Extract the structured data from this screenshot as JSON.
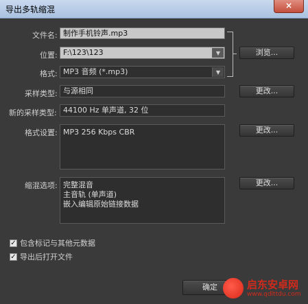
{
  "window": {
    "title": "导出多轨缩混",
    "close_glyph": "×"
  },
  "file_name": {
    "label": "文件名:",
    "value": "制作手机铃声.mp3"
  },
  "location": {
    "label": "位置:",
    "value": "F:\\123\\123",
    "browse_label": "浏览..."
  },
  "format": {
    "label": "格式:",
    "value": "MP3 音频 (*.mp3)"
  },
  "sample_type": {
    "label": "采样类型:",
    "value": "与源相同",
    "change_label": "更改..."
  },
  "new_sample_type": {
    "label": "新的采样类型:",
    "value": "44100 Hz 单声道, 32 位"
  },
  "format_settings": {
    "label": "格式设置:",
    "value": "MP3 256 Kbps CBR",
    "change_label": "更改..."
  },
  "mix_options": {
    "label": "缩混选项:",
    "lines": [
      "完整混音",
      "主音轨 (单声道)",
      "嵌入编辑原始链接数据"
    ],
    "change_label": "更改..."
  },
  "checkboxes": [
    {
      "label": "包含标记与其他元数据",
      "checked": true
    },
    {
      "label": "导出后打开文件",
      "checked": true
    }
  ],
  "ok_button": {
    "label": "确定"
  },
  "watermark": {
    "name": "启东安卓网",
    "url": "www.qdlttdu.com"
  },
  "icons": {
    "dropdown": "triangle-down",
    "check": "✓"
  }
}
